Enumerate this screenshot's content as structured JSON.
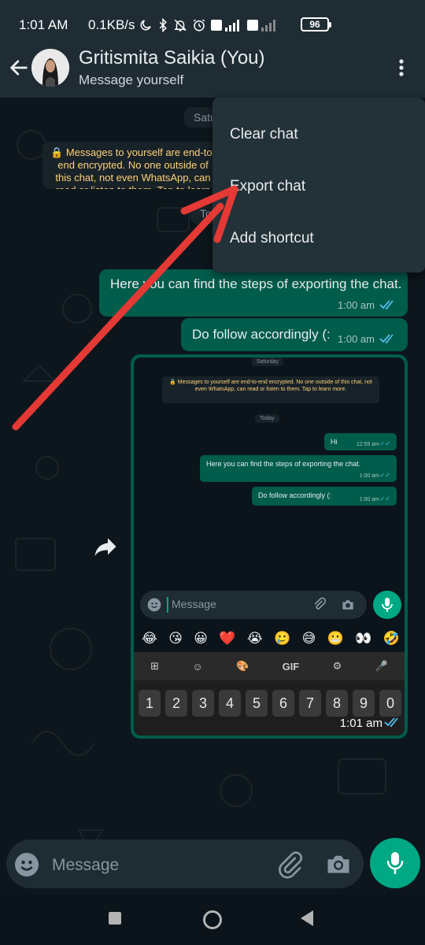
{
  "status_bar": {
    "time": "1:01 AM",
    "speed": "0.1KB/s",
    "battery": "96"
  },
  "header": {
    "contact_name": "Gritismita Saikia (You)",
    "subtitle": "Message yourself"
  },
  "chat": {
    "date_saturday": "Satu",
    "date_today": "Tod",
    "encryption_notice": "🔒 Messages to yourself are end-to-end encrypted. No one outside of this chat, not even WhatsApp, can read or listen to them. Tap to learn more.",
    "messages": [
      {
        "text": "Here you can find the steps of exporting the chat.",
        "time": "1:00 am"
      },
      {
        "text": "Do follow accordingly (:",
        "time": "1:00 am"
      }
    ],
    "image_time": "1:01 am"
  },
  "screenshot_preview": {
    "date_saturday": "Saturday",
    "encryption_notice": "🔒 Messages to yourself are end-to-end encrypted. No one outside of this chat, not even WhatsApp, can read or listen to them. Tap to learn more.",
    "date_today": "Today",
    "messages": [
      {
        "text": "Hi",
        "time": "12:59 am"
      },
      {
        "text": "Here you can find the steps of exporting the chat.",
        "time": "1:00 am"
      },
      {
        "text": "Do follow accordingly (:",
        "time": "1:00 am"
      }
    ],
    "input_placeholder": "Message",
    "emojis": [
      "😂",
      "😘",
      "😀",
      "❤️",
      "😭",
      "🥲",
      "😅",
      "😬",
      "👀",
      "🤣"
    ],
    "keyboard_toolbar": [
      "⊞",
      "☺",
      "🎨",
      "GIF",
      "⚙",
      "🎤"
    ],
    "number_keys": [
      "1",
      "2",
      "3",
      "4",
      "5",
      "6",
      "7",
      "8",
      "9",
      "0"
    ]
  },
  "context_menu": {
    "items": [
      "Clear chat",
      "Export chat",
      "Add shortcut"
    ]
  },
  "input": {
    "placeholder": "Message"
  },
  "colors": {
    "accent": "#00a884",
    "bubble_out": "#005c4b",
    "header_bg": "#1f2c34",
    "annotation_arrow": "#e53935",
    "read_ticks": "#53bdeb"
  }
}
